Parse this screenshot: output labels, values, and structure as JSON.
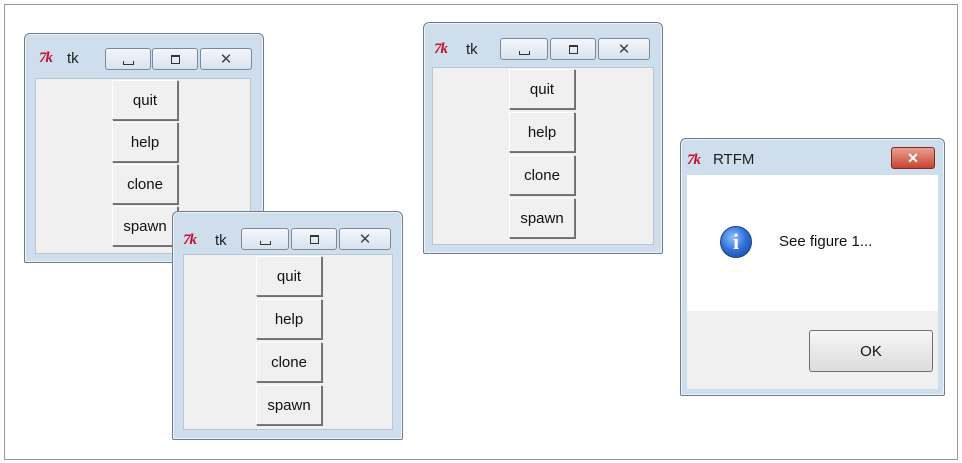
{
  "windows": [
    {
      "title": "tk",
      "logo": "7k",
      "controls": {
        "minimize": "minimize-icon",
        "maximize": "maximize-icon",
        "close": "close-icon"
      },
      "buttons": [
        "quit",
        "help",
        "clone",
        "spawn"
      ]
    },
    {
      "title": "tk",
      "logo": "7k",
      "controls": {
        "minimize": "minimize-icon",
        "maximize": "maximize-icon",
        "close": "close-icon"
      },
      "buttons": [
        "quit",
        "help",
        "clone",
        "spawn"
      ]
    },
    {
      "title": "tk",
      "logo": "7k",
      "controls": {
        "minimize": "minimize-icon",
        "maximize": "maximize-icon",
        "close": "close-icon"
      },
      "buttons": [
        "quit",
        "help",
        "clone",
        "spawn"
      ]
    }
  ],
  "dialog": {
    "title": "RTFM",
    "logo": "7k",
    "message": "See figure 1...",
    "icon": "info-icon",
    "ok_label": "OK",
    "close_icon": "close-icon"
  },
  "colors": {
    "titlebar": "#cfdeed",
    "client": "#f0f0f0",
    "close_red": "#c6452e",
    "tk_logo": "#c8102e"
  }
}
